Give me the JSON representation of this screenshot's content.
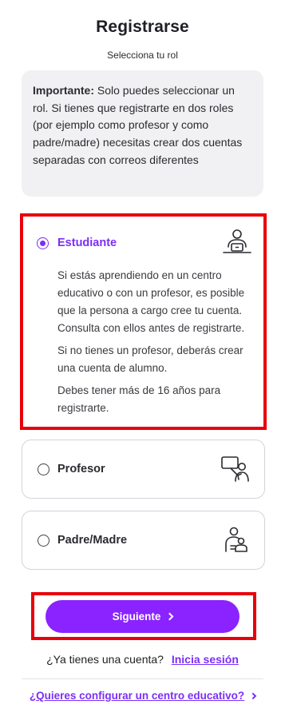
{
  "header": {
    "title": "Registrarse",
    "subtitle": "Selecciona tu rol"
  },
  "notice": {
    "bold": "Importante:",
    "text": " Solo puedes seleccionar un rol. Si tienes que registrarte en dos roles (por ejemplo como profesor y como padre/madre) necesitas crear dos cuentas separadas con correos diferentes"
  },
  "roles": {
    "student": {
      "label": "Estudiante",
      "selected": true,
      "icon": "student-laptop-icon",
      "desc1": "Si estás aprendiendo en un centro educativo o con un profesor, es posible que la persona a cargo cree tu cuenta. Consulta con ellos antes de registrarte.",
      "desc2": "Si no tienes un profesor, deberás crear una cuenta de alumno.",
      "desc3": "Debes tener más de 16 años para registrarte."
    },
    "teacher": {
      "label": "Profesor",
      "selected": false,
      "icon": "teacher-board-icon"
    },
    "parent": {
      "label": "Padre/Madre",
      "selected": false,
      "icon": "parent-child-icon"
    }
  },
  "actions": {
    "next_label": "Siguiente",
    "have_account": "¿Ya tienes una cuenta?",
    "login_link": "Inicia sesión",
    "school_link": "¿Quieres configurar un centro educativo?"
  },
  "colors": {
    "accent": "#7b2ff7",
    "button": "#8a23ff",
    "highlight": "#e8000b",
    "notice_bg": "#f1f1f3"
  }
}
